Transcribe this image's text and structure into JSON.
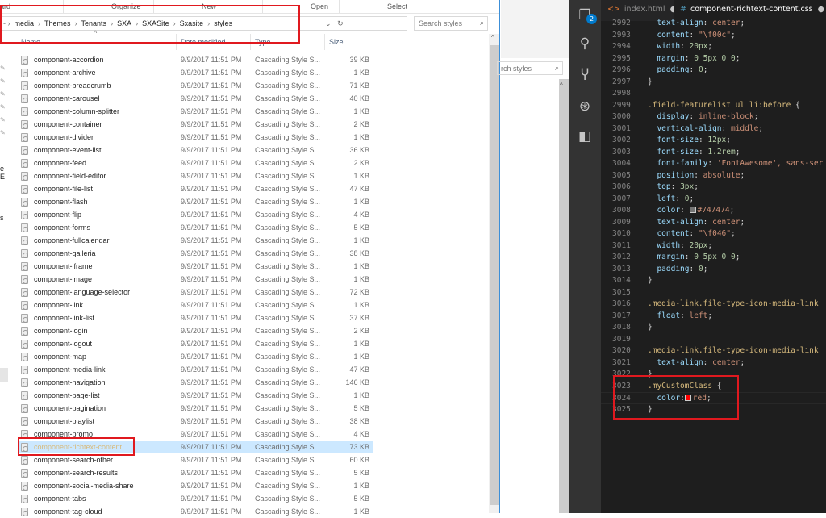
{
  "explorer": {
    "ribbon": [
      "ard",
      "Organize",
      "New",
      "Open",
      "Select"
    ],
    "breadcrumb": [
      "media",
      "Themes",
      "Tenants",
      "SXA",
      "SXASite",
      "Sxasite",
      "styles"
    ],
    "search_placeholder": "Search styles",
    "columns": {
      "name": "Name",
      "date": "Date modified",
      "type": "Type",
      "size": "Size"
    },
    "nav_fragments": [
      "e E",
      "s"
    ],
    "files": [
      {
        "name": "component-accordion",
        "date": "9/9/2017 11:51 PM",
        "type": "Cascading Style S...",
        "size": "39 KB"
      },
      {
        "name": "component-archive",
        "date": "9/9/2017 11:51 PM",
        "type": "Cascading Style S...",
        "size": "1 KB"
      },
      {
        "name": "component-breadcrumb",
        "date": "9/9/2017 11:51 PM",
        "type": "Cascading Style S...",
        "size": "71 KB"
      },
      {
        "name": "component-carousel",
        "date": "9/9/2017 11:51 PM",
        "type": "Cascading Style S...",
        "size": "40 KB"
      },
      {
        "name": "component-column-splitter",
        "date": "9/9/2017 11:51 PM",
        "type": "Cascading Style S...",
        "size": "1 KB"
      },
      {
        "name": "component-container",
        "date": "9/9/2017 11:51 PM",
        "type": "Cascading Style S...",
        "size": "2 KB"
      },
      {
        "name": "component-divider",
        "date": "9/9/2017 11:51 PM",
        "type": "Cascading Style S...",
        "size": "1 KB"
      },
      {
        "name": "component-event-list",
        "date": "9/9/2017 11:51 PM",
        "type": "Cascading Style S...",
        "size": "36 KB"
      },
      {
        "name": "component-feed",
        "date": "9/9/2017 11:51 PM",
        "type": "Cascading Style S...",
        "size": "2 KB"
      },
      {
        "name": "component-field-editor",
        "date": "9/9/2017 11:51 PM",
        "type": "Cascading Style S...",
        "size": "1 KB"
      },
      {
        "name": "component-file-list",
        "date": "9/9/2017 11:51 PM",
        "type": "Cascading Style S...",
        "size": "47 KB"
      },
      {
        "name": "component-flash",
        "date": "9/9/2017 11:51 PM",
        "type": "Cascading Style S...",
        "size": "1 KB"
      },
      {
        "name": "component-flip",
        "date": "9/9/2017 11:51 PM",
        "type": "Cascading Style S...",
        "size": "4 KB"
      },
      {
        "name": "component-forms",
        "date": "9/9/2017 11:51 PM",
        "type": "Cascading Style S...",
        "size": "5 KB"
      },
      {
        "name": "component-fullcalendar",
        "date": "9/9/2017 11:51 PM",
        "type": "Cascading Style S...",
        "size": "1 KB"
      },
      {
        "name": "component-galleria",
        "date": "9/9/2017 11:51 PM",
        "type": "Cascading Style S...",
        "size": "38 KB"
      },
      {
        "name": "component-iframe",
        "date": "9/9/2017 11:51 PM",
        "type": "Cascading Style S...",
        "size": "1 KB"
      },
      {
        "name": "component-image",
        "date": "9/9/2017 11:51 PM",
        "type": "Cascading Style S...",
        "size": "1 KB"
      },
      {
        "name": "component-language-selector",
        "date": "9/9/2017 11:51 PM",
        "type": "Cascading Style S...",
        "size": "72 KB"
      },
      {
        "name": "component-link",
        "date": "9/9/2017 11:51 PM",
        "type": "Cascading Style S...",
        "size": "1 KB"
      },
      {
        "name": "component-link-list",
        "date": "9/9/2017 11:51 PM",
        "type": "Cascading Style S...",
        "size": "37 KB"
      },
      {
        "name": "component-login",
        "date": "9/9/2017 11:51 PM",
        "type": "Cascading Style S...",
        "size": "2 KB"
      },
      {
        "name": "component-logout",
        "date": "9/9/2017 11:51 PM",
        "type": "Cascading Style S...",
        "size": "1 KB"
      },
      {
        "name": "component-map",
        "date": "9/9/2017 11:51 PM",
        "type": "Cascading Style S...",
        "size": "1 KB"
      },
      {
        "name": "component-media-link",
        "date": "9/9/2017 11:51 PM",
        "type": "Cascading Style S...",
        "size": "47 KB"
      },
      {
        "name": "component-navigation",
        "date": "9/9/2017 11:51 PM",
        "type": "Cascading Style S...",
        "size": "146 KB"
      },
      {
        "name": "component-page-list",
        "date": "9/9/2017 11:51 PM",
        "type": "Cascading Style S...",
        "size": "1 KB"
      },
      {
        "name": "component-pagination",
        "date": "9/9/2017 11:51 PM",
        "type": "Cascading Style S...",
        "size": "5 KB"
      },
      {
        "name": "component-playlist",
        "date": "9/9/2017 11:51 PM",
        "type": "Cascading Style S...",
        "size": "38 KB"
      },
      {
        "name": "component-promo",
        "date": "9/9/2017 11:51 PM",
        "type": "Cascading Style S...",
        "size": "4 KB"
      },
      {
        "name": "component-richtext-content",
        "date": "9/9/2017 11:51 PM",
        "type": "Cascading Style S...",
        "size": "73 KB",
        "selected": true
      },
      {
        "name": "component-search-other",
        "date": "9/9/2017 11:51 PM",
        "type": "Cascading Style S...",
        "size": "60 KB"
      },
      {
        "name": "component-search-results",
        "date": "9/9/2017 11:51 PM",
        "type": "Cascading Style S...",
        "size": "5 KB"
      },
      {
        "name": "component-social-media-share",
        "date": "9/9/2017 11:51 PM",
        "type": "Cascading Style S...",
        "size": "1 KB"
      },
      {
        "name": "component-tabs",
        "date": "9/9/2017 11:51 PM",
        "type": "Cascading Style S...",
        "size": "5 KB"
      },
      {
        "name": "component-tag-cloud",
        "date": "9/9/2017 11:51 PM",
        "type": "Cascading Style S...",
        "size": "1 KB"
      }
    ]
  },
  "second_window": {
    "search_placeholder": "rch styles"
  },
  "vscode": {
    "badge": "2",
    "tabs": [
      {
        "icon": "<>",
        "label": "index.html",
        "active": false
      },
      {
        "icon": "#",
        "label": "component-richtext-content.css",
        "active": true
      }
    ],
    "lines": [
      {
        "n": "2992",
        "t": [
          [
            "  ",
            "pu"
          ],
          [
            "text-align",
            "p"
          ],
          [
            ": ",
            "pu"
          ],
          [
            "center",
            "v"
          ],
          [
            ";",
            "pu"
          ]
        ]
      },
      {
        "n": "2993",
        "t": [
          [
            "  ",
            "pu"
          ],
          [
            "content",
            "p"
          ],
          [
            ": ",
            "pu"
          ],
          [
            "\"\\f00c\"",
            "v"
          ],
          [
            ";",
            "pu"
          ]
        ]
      },
      {
        "n": "2994",
        "t": [
          [
            "  ",
            "pu"
          ],
          [
            "width",
            "p"
          ],
          [
            ": ",
            "pu"
          ],
          [
            "20px",
            "nm"
          ],
          [
            ";",
            "pu"
          ]
        ]
      },
      {
        "n": "2995",
        "t": [
          [
            "  ",
            "pu"
          ],
          [
            "margin",
            "p"
          ],
          [
            ": ",
            "pu"
          ],
          [
            "0 5px 0 0",
            "nm"
          ],
          [
            ";",
            "pu"
          ]
        ]
      },
      {
        "n": "2996",
        "t": [
          [
            "  ",
            "pu"
          ],
          [
            "padding",
            "p"
          ],
          [
            ": ",
            "pu"
          ],
          [
            "0",
            "nm"
          ],
          [
            ";",
            "pu"
          ]
        ]
      },
      {
        "n": "2997",
        "t": [
          [
            "}",
            "pu"
          ]
        ]
      },
      {
        "n": "2998",
        "t": []
      },
      {
        "n": "2999",
        "t": [
          [
            ".field-featurelist ul li:before",
            "sel"
          ],
          [
            " {",
            "pu"
          ]
        ]
      },
      {
        "n": "3000",
        "t": [
          [
            "  ",
            "pu"
          ],
          [
            "display",
            "p"
          ],
          [
            ": ",
            "pu"
          ],
          [
            "inline-block",
            "v"
          ],
          [
            ";",
            "pu"
          ]
        ]
      },
      {
        "n": "3001",
        "t": [
          [
            "  ",
            "pu"
          ],
          [
            "vertical-align",
            "p"
          ],
          [
            ": ",
            "pu"
          ],
          [
            "middle",
            "v"
          ],
          [
            ";",
            "pu"
          ]
        ]
      },
      {
        "n": "3002",
        "t": [
          [
            "  ",
            "pu"
          ],
          [
            "font-size",
            "p"
          ],
          [
            ": ",
            "pu"
          ],
          [
            "12px",
            "nm"
          ],
          [
            ";",
            "pu"
          ]
        ]
      },
      {
        "n": "3003",
        "t": [
          [
            "  ",
            "pu"
          ],
          [
            "font-size",
            "p"
          ],
          [
            ": ",
            "pu"
          ],
          [
            "1.2rem",
            "nm"
          ],
          [
            ";",
            "pu"
          ]
        ]
      },
      {
        "n": "3004",
        "t": [
          [
            "  ",
            "pu"
          ],
          [
            "font-family",
            "p"
          ],
          [
            ": ",
            "pu"
          ],
          [
            "'FontAwesome', sans-ser",
            "v"
          ]
        ]
      },
      {
        "n": "3005",
        "t": [
          [
            "  ",
            "pu"
          ],
          [
            "position",
            "p"
          ],
          [
            ": ",
            "pu"
          ],
          [
            "absolute",
            "v"
          ],
          [
            ";",
            "pu"
          ]
        ]
      },
      {
        "n": "3006",
        "t": [
          [
            "  ",
            "pu"
          ],
          [
            "top",
            "p"
          ],
          [
            ": ",
            "pu"
          ],
          [
            "3px",
            "nm"
          ],
          [
            ";",
            "pu"
          ]
        ]
      },
      {
        "n": "3007",
        "t": [
          [
            "  ",
            "pu"
          ],
          [
            "left",
            "p"
          ],
          [
            ": ",
            "pu"
          ],
          [
            "0",
            "nm"
          ],
          [
            ";",
            "pu"
          ]
        ]
      },
      {
        "n": "3008",
        "t": [
          [
            "  ",
            "pu"
          ],
          [
            "color",
            "p"
          ],
          [
            ": ",
            "pu"
          ],
          [
            "#747474",
            "v"
          ],
          [
            ";",
            "pu"
          ]
        ],
        "swatch": "#747474"
      },
      {
        "n": "3009",
        "t": [
          [
            "  ",
            "pu"
          ],
          [
            "text-align",
            "p"
          ],
          [
            ": ",
            "pu"
          ],
          [
            "center",
            "v"
          ],
          [
            ";",
            "pu"
          ]
        ]
      },
      {
        "n": "3010",
        "t": [
          [
            "  ",
            "pu"
          ],
          [
            "content",
            "p"
          ],
          [
            ": ",
            "pu"
          ],
          [
            "\"\\f046\"",
            "v"
          ],
          [
            ";",
            "pu"
          ]
        ]
      },
      {
        "n": "3011",
        "t": [
          [
            "  ",
            "pu"
          ],
          [
            "width",
            "p"
          ],
          [
            ": ",
            "pu"
          ],
          [
            "20px",
            "nm"
          ],
          [
            ";",
            "pu"
          ]
        ]
      },
      {
        "n": "3012",
        "t": [
          [
            "  ",
            "pu"
          ],
          [
            "margin",
            "p"
          ],
          [
            ": ",
            "pu"
          ],
          [
            "0 5px 0 0",
            "nm"
          ],
          [
            ";",
            "pu"
          ]
        ]
      },
      {
        "n": "3013",
        "t": [
          [
            "  ",
            "pu"
          ],
          [
            "padding",
            "p"
          ],
          [
            ": ",
            "pu"
          ],
          [
            "0",
            "nm"
          ],
          [
            ";",
            "pu"
          ]
        ]
      },
      {
        "n": "3014",
        "t": [
          [
            "}",
            "pu"
          ]
        ]
      },
      {
        "n": "3015",
        "t": []
      },
      {
        "n": "3016",
        "t": [
          [
            ".media-link.file-type-icon-media-link",
            "sel"
          ]
        ]
      },
      {
        "n": "3017",
        "t": [
          [
            "  ",
            "pu"
          ],
          [
            "float",
            "p"
          ],
          [
            ": ",
            "pu"
          ],
          [
            "left",
            "v"
          ],
          [
            ";",
            "pu"
          ]
        ]
      },
      {
        "n": "3018",
        "t": [
          [
            "}",
            "pu"
          ]
        ]
      },
      {
        "n": "3019",
        "t": []
      },
      {
        "n": "3020",
        "t": [
          [
            ".media-link.file-type-icon-media-link",
            "sel"
          ]
        ]
      },
      {
        "n": "3021",
        "t": [
          [
            "  ",
            "pu"
          ],
          [
            "text-align",
            "p"
          ],
          [
            ": ",
            "pu"
          ],
          [
            "center",
            "v"
          ],
          [
            ";",
            "pu"
          ]
        ]
      },
      {
        "n": "3022",
        "t": [
          [
            "}",
            "pu"
          ]
        ]
      },
      {
        "n": "3023",
        "t": [
          [
            ".myCustomClass",
            "sel"
          ],
          [
            " {",
            "pu"
          ]
        ]
      },
      {
        "n": "3024",
        "t": [
          [
            "  ",
            "pu"
          ],
          [
            "color",
            "p"
          ],
          [
            ":",
            "pu"
          ],
          [
            "red",
            "v"
          ],
          [
            ";",
            "pu"
          ]
        ],
        "swatch": "#ff0000",
        "current": true
      },
      {
        "n": "3025",
        "t": [
          [
            "}",
            "pu"
          ]
        ]
      }
    ]
  },
  "colors": {
    "highlight_box": "#e0191f",
    "selection": "#cce8ff",
    "vscode_bg": "#1e1e1e",
    "accent": "#007acc"
  }
}
